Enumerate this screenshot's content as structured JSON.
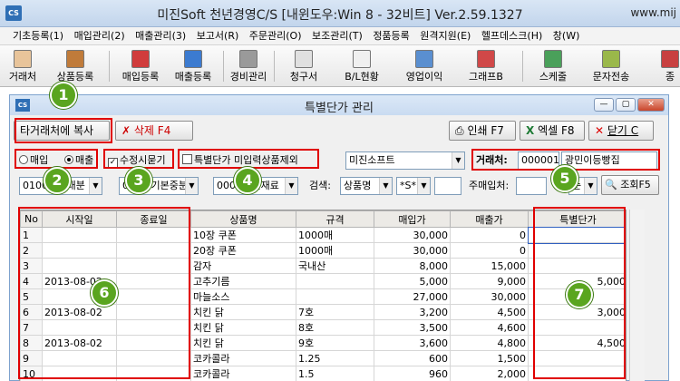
{
  "window": {
    "title": "미진Soft 천년경영C/S [내윈도우:Win 8 - 32비트] Ver.2.59.1327",
    "url": "www.mij",
    "icon": "CS"
  },
  "menu": [
    "기초등록(1)",
    "매입관리(2)",
    "매출관리(3)",
    "보고서(R)",
    "주문관리(O)",
    "보조관리(T)",
    "정품등록",
    "원격지원(E)",
    "헬프데스크(H)",
    "창(W)"
  ],
  "toolbar": [
    "거래처",
    "상품등록",
    "매입등록",
    "매출등록",
    "경비관리",
    "청구서",
    "B/L현황",
    "영업이익",
    "그래프B",
    "스케줄",
    "문자전송",
    "종"
  ],
  "subwindow": {
    "title": "특별단가 관리",
    "icon": "CS",
    "btn_copy": "타거래처에 복사",
    "btn_delete": "삭제 F4",
    "btn_print": "인쇄 F7",
    "btn_excel": "엑셀 F8",
    "btn_close": "닫기 C",
    "win_min": "—",
    "win_max": "▢",
    "win_close": "✕"
  },
  "filters": {
    "radio_purchase": "매입",
    "radio_sales": "매출",
    "check_edit": "수정시묻기",
    "check_exclude": "특별단가 미입력상품제외",
    "company": "미진소프트",
    "client_label": "거래처:",
    "client_code": "000001",
    "client_name": "광민이등빵집",
    "combo1": "01000본 대분",
    "combo2": "0100 기본중분",
    "combo3": "0000 1인재료",
    "search_label": "검색:",
    "search_field": "상품명",
    "search_pattern": "*S*",
    "main_buyer_label": "주매입처:",
    "sort": "순",
    "btn_search": "조회F5"
  },
  "badges": [
    "1",
    "2",
    "3",
    "4",
    "5",
    "6",
    "7"
  ],
  "table": {
    "headers": [
      "No",
      "시작일",
      "종료일",
      "상품명",
      "규격",
      "매입가",
      "매출가",
      "특별단가"
    ],
    "rows": [
      [
        "1",
        "",
        "",
        "10장 쿠폰",
        "1000매",
        "30,000",
        "0",
        ""
      ],
      [
        "2",
        "",
        "",
        "20장 쿠폰",
        "1000매",
        "30,000",
        "0",
        ""
      ],
      [
        "3",
        "",
        "",
        "감자",
        "국내산",
        "8,000",
        "15,000",
        ""
      ],
      [
        "4",
        "2013-08-02",
        "",
        "고추기름",
        "",
        "5,000",
        "9,000",
        "5,000"
      ],
      [
        "5",
        "",
        "",
        "마늘소스",
        "",
        "27,000",
        "30,000",
        ""
      ],
      [
        "6",
        "2013-08-02",
        "",
        "치킨 닭",
        "7호",
        "3,200",
        "4,500",
        "3,000"
      ],
      [
        "7",
        "",
        "",
        "치킨 닭",
        "8호",
        "3,500",
        "4,600",
        ""
      ],
      [
        "8",
        "2013-08-02",
        "",
        "치킨 닭",
        "9호",
        "3,600",
        "4,800",
        "4,500"
      ],
      [
        "9",
        "",
        "",
        "코카콜라",
        "1.25",
        "600",
        "1,500",
        ""
      ],
      [
        "10",
        "",
        "",
        "코카콜라",
        "1.5",
        "960",
        "2,000",
        ""
      ]
    ]
  }
}
